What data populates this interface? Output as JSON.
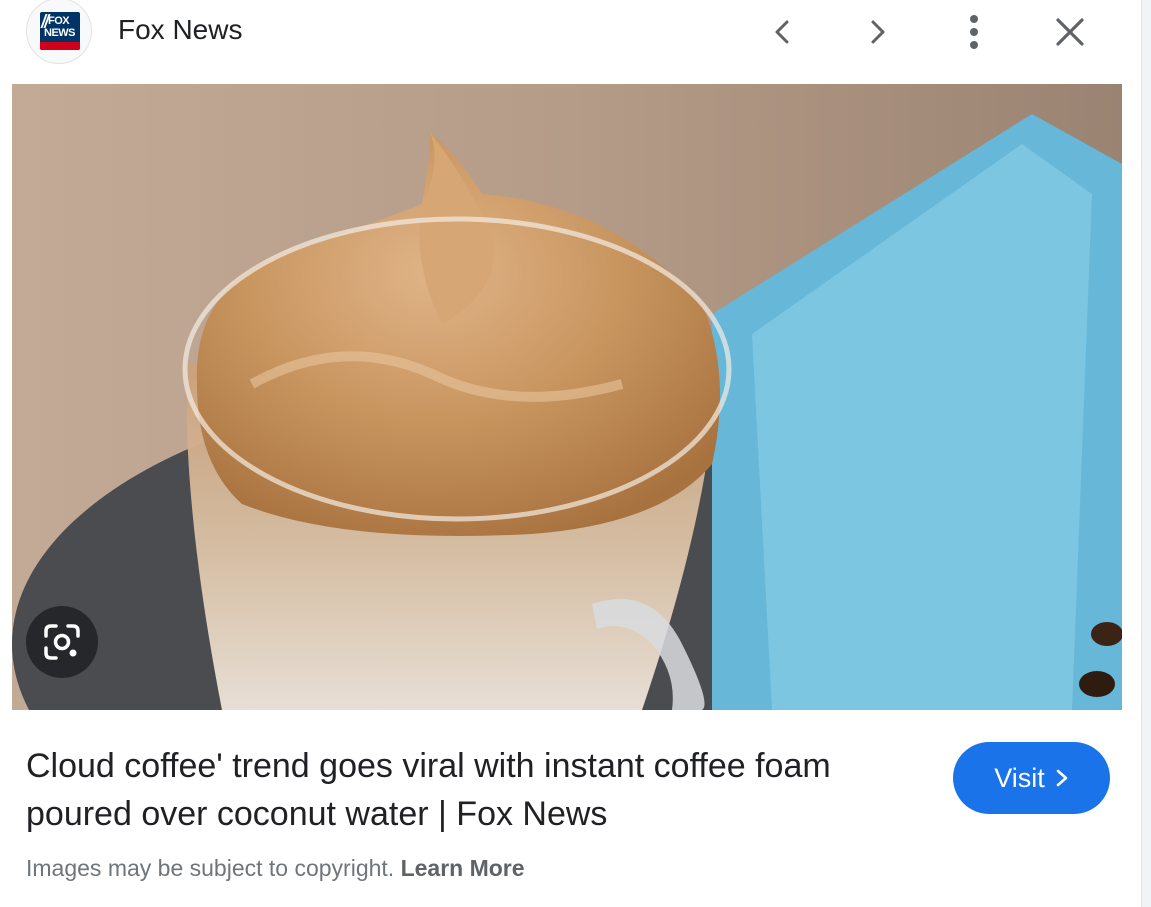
{
  "header": {
    "logo_text_top": "FOX",
    "logo_text_bottom": "NEWS",
    "site_name": "Fox News",
    "icons": [
      "chevron-left-icon",
      "chevron-right-icon",
      "more-vert-icon",
      "close-icon"
    ]
  },
  "image": {
    "subject": "cloud coffee in glass mug",
    "lens_icon": "google-lens-icon"
  },
  "caption": {
    "title": "Cloud coffee' trend goes viral with instant coffee foam poured over coconut water | Fox News",
    "visit_label": "Visit",
    "copyright_text": "Images may be subject to copyright.",
    "learn_more": "Learn More"
  },
  "colors": {
    "accent": "#1a73e8",
    "text": "#202124",
    "secondary_text": "#70757a"
  }
}
